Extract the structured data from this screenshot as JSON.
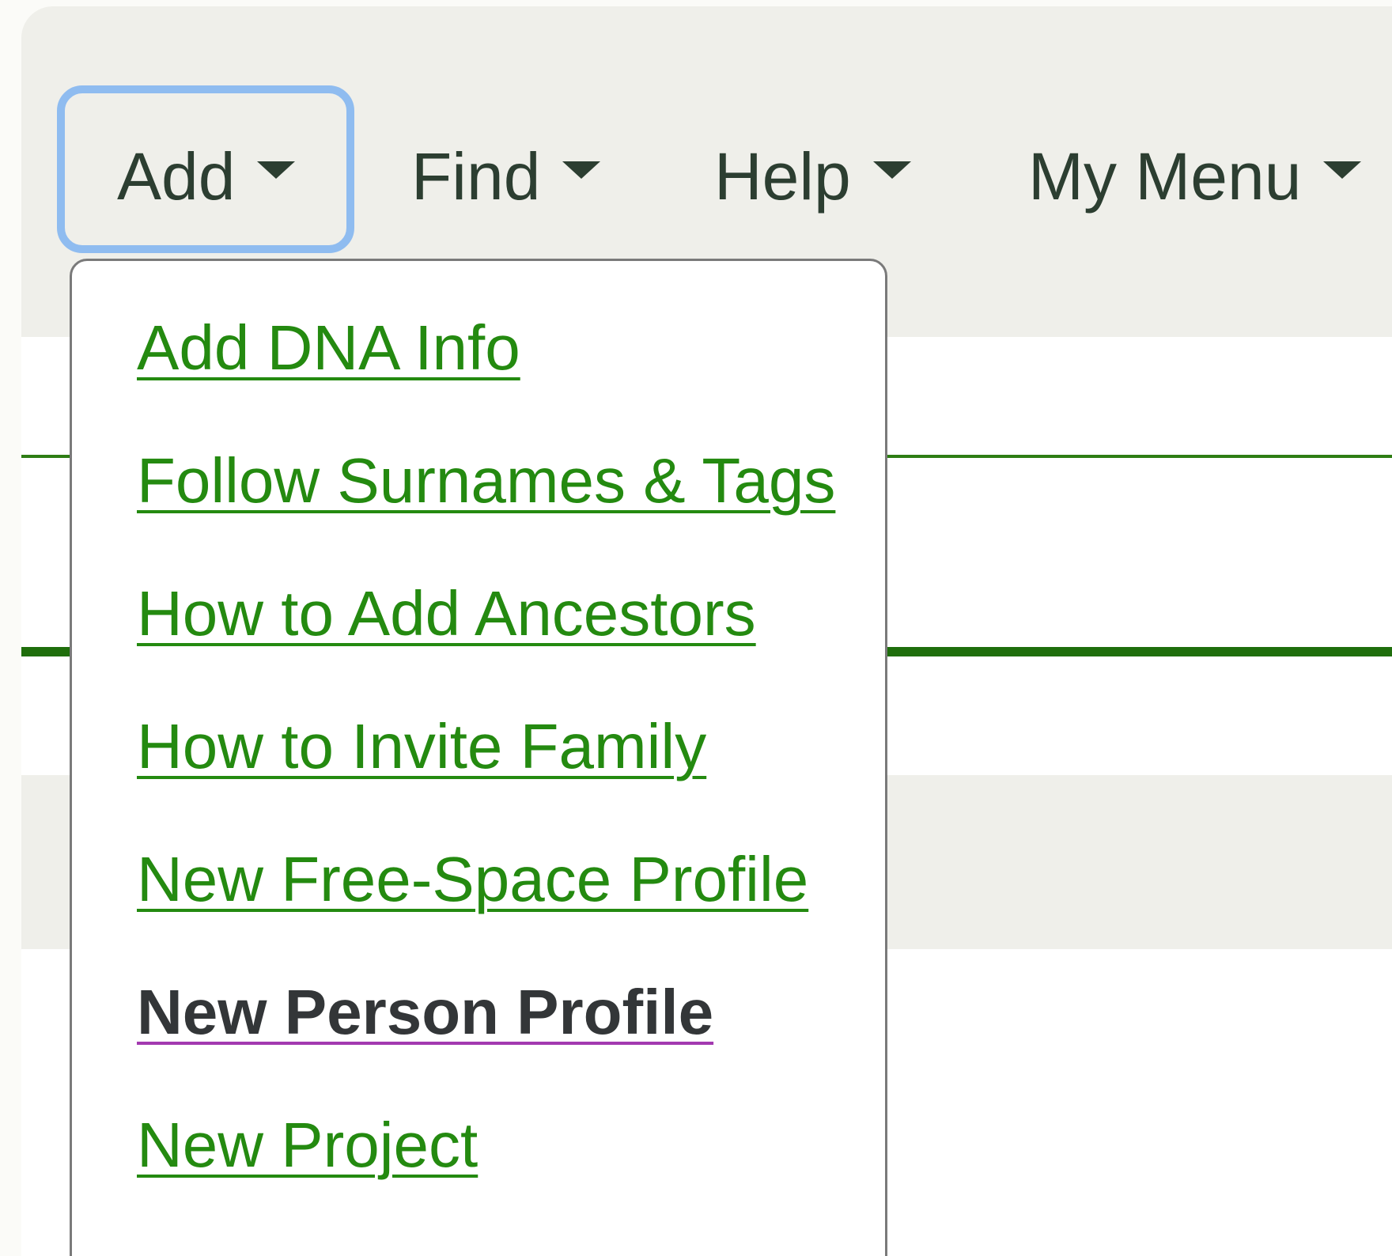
{
  "nav": {
    "items": [
      {
        "label": "Add",
        "focused": true
      },
      {
        "label": "Find",
        "focused": false
      },
      {
        "label": "Help",
        "focused": false
      },
      {
        "label": "My Menu",
        "focused": false
      }
    ]
  },
  "add_menu": {
    "items": [
      {
        "label": "Add DNA Info"
      },
      {
        "label": "Follow Surnames & Tags"
      },
      {
        "label": "How to Add Ancestors"
      },
      {
        "label": "How to Invite Family"
      },
      {
        "label": "New Free-Space Profile"
      },
      {
        "label": "New Person Profile",
        "visited": true
      },
      {
        "label": "New Project"
      }
    ]
  },
  "colors": {
    "link": "#248a10",
    "visited_text": "#333638",
    "visited_underline": "#a33ab0",
    "focus_ring": "#8fbcf0",
    "header_bg": "#efefea",
    "rule": "#2e7d14"
  }
}
